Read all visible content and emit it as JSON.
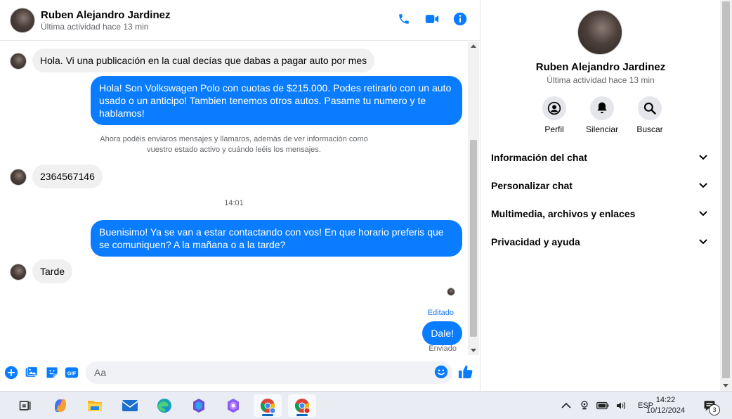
{
  "contact": {
    "name": "Ruben Alejandro Jardinez",
    "status": "Última actividad hace 13 min"
  },
  "messages": {
    "in_1": "Hola. Vi una publicación en la cual decías que dabas a pagar auto por mes",
    "out_1": "Hola! Son Volkswagen Polo con cuotas de $215.000. Podes retirarlo con un auto usado o un anticipo! Tambien tenemos otros autos. Pasame tu numero y te hablamos!",
    "system_note": "Ahora podéis enviaros mensajes y llamaros, además de ver información como vuestro estado activo y cuándo leéis los mensajes.",
    "in_2": "2364567146",
    "time_separator": "14:01",
    "out_2": "Buenisimo! Ya se van a estar contactando con vos! En que horario preferis que se comuniquen? A la mañana o a la tarde?",
    "in_3": "Tarde",
    "edited_label": "Editado",
    "out_3": "Dale!",
    "sent_label": "Enviado"
  },
  "composer": {
    "placeholder": "Aa",
    "gif_label": "GIF"
  },
  "panel": {
    "actions": [
      {
        "label": "Perfil",
        "icon": "profile-icon"
      },
      {
        "label": "Silenciar",
        "icon": "bell-icon"
      },
      {
        "label": "Buscar",
        "icon": "search-icon"
      }
    ],
    "sections": [
      {
        "label": "Información del chat"
      },
      {
        "label": "Personalizar chat"
      },
      {
        "label": "Multimedia, archivos y enlaces"
      },
      {
        "label": "Privacidad y ayuda"
      }
    ]
  },
  "taskbar": {
    "language": "ESP",
    "time": "14:22",
    "date": "10/12/2024",
    "notification_count": "3",
    "brand_color": "#0067c0"
  },
  "colors": {
    "accent": "#0a7cff",
    "incoming_bubble": "#f0f0f0"
  }
}
